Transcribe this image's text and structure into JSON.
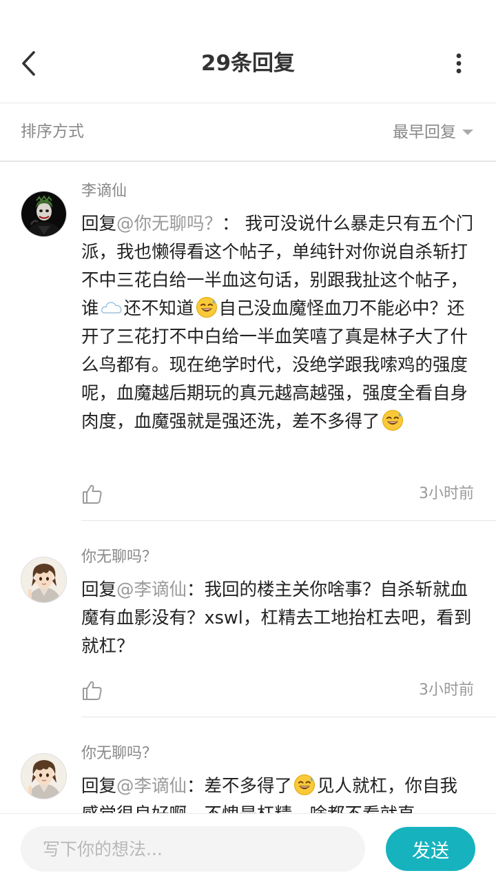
{
  "header": {
    "title": "29条回复",
    "back_icon": "chevron-left-icon",
    "more_icon": "vertical-ellipsis-icon"
  },
  "sort": {
    "label": "排序方式",
    "value": "最早回复",
    "icon": "caret-down-icon"
  },
  "comments": [
    {
      "author": "李谪仙",
      "reply_prefix": "回复",
      "mention": "@你无聊吗？",
      "segments": [
        "：  我可没说什么暴走只有五个门派，我也懒得看这个帖子，单纯针对你说自杀斩打不中三花白给一半血这句话，别跟我扯这个帖子，谁",
        "还不知道",
        "自己没血魔怪血刀不能必中？还开了三花打不中白给一半血笑嘻了真是林子大了什么鸟都有。现在绝学时代，没绝学跟我嗦鸡的强度呢，血魔越后期玩的真元越高越强，强度全看自身肉度，血魔强就是强还洗，差不多得了"
      ],
      "emojis": [
        "cloud-emoji",
        "sweat-smile-emoji",
        "sweat-smile-emoji"
      ],
      "time": "3小时前",
      "avatar": "joker-avatar"
    },
    {
      "author": "你无聊吗？",
      "reply_prefix": "回复",
      "mention": "@李谪仙",
      "segments": [
        "：我回的楼主关你啥事？自杀斩就血魔有血影没有？xswl，杠精去工地抬杠去吧，看到就杠？"
      ],
      "time": "3小时前",
      "avatar": "anime-boy-avatar"
    },
    {
      "author": "你无聊吗？",
      "reply_prefix": "回复",
      "mention": "@李谪仙",
      "segments": [
        "：差不多得了",
        "见人就杠，你自我感觉很良好啊，不愧是杠精，啥都不看就直"
      ],
      "emojis": [
        "sweat-smile-emoji"
      ],
      "avatar": "anime-boy-avatar"
    }
  ],
  "composer": {
    "placeholder": "写下你的想法...",
    "send_label": "发送"
  },
  "colors": {
    "accent": "#16b3bf",
    "mention": "#9a9a9a",
    "secondary_text": "#888888"
  }
}
